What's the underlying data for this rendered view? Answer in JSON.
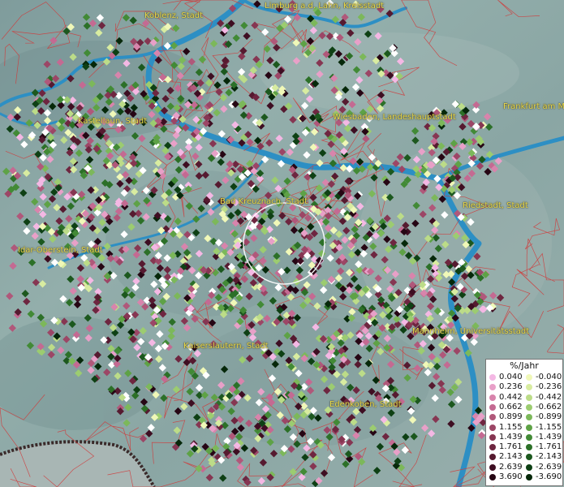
{
  "colors": {
    "river": "#2d8fc4",
    "border": "#d03a3a",
    "city_label": "#e8d84a"
  },
  "cities": [
    {
      "name": "Koblenz, Stadt"
    },
    {
      "name": "Limburg a.d. Lahn, Kreisstadt"
    },
    {
      "name": "Kastellaun, Stadt"
    },
    {
      "name": "Wiesbaden, Landeshauptstadt"
    },
    {
      "name": "Frankfurt am M"
    },
    {
      "name": "Bad Kreuznach, Stadt"
    },
    {
      "name": "Riedstadt, Stadt"
    },
    {
      "name": "Idar-Oberstein, Stadt"
    },
    {
      "name": "Mannheim, Universitätsstadt"
    },
    {
      "name": "Kaiserslautern, Stadt"
    },
    {
      "name": "Edenkoben, Stadt"
    }
  ],
  "legend": {
    "title": "%/Jahr",
    "positive": [
      {
        "label": "0.040",
        "color": "#f4b8e4"
      },
      {
        "label": "0.236",
        "color": "#e8a0c8"
      },
      {
        "label": "0.442",
        "color": "#d884ac"
      },
      {
        "label": "0.662",
        "color": "#c46a92"
      },
      {
        "label": "0.899",
        "color": "#b0587a"
      },
      {
        "label": "1.155",
        "color": "#9c4666"
      },
      {
        "label": "1.439",
        "color": "#863652"
      },
      {
        "label": "1.761",
        "color": "#6e2640"
      },
      {
        "label": "2.143",
        "color": "#561a30"
      },
      {
        "label": "2.639",
        "color": "#3e0e22"
      },
      {
        "label": "3.690",
        "color": "#260614"
      }
    ],
    "negative": [
      {
        "label": "-0.040",
        "color": "#f0f8b8"
      },
      {
        "label": "-0.236",
        "color": "#d8eca0"
      },
      {
        "label": "-0.442",
        "color": "#bcdc88"
      },
      {
        "label": "-0.662",
        "color": "#9ccc70"
      },
      {
        "label": "-0.899",
        "color": "#7cb85a"
      },
      {
        "label": "-1.155",
        "color": "#5ea246"
      },
      {
        "label": "-1.439",
        "color": "#428a36"
      },
      {
        "label": "-1.761",
        "color": "#2c7028"
      },
      {
        "label": "-2.143",
        "color": "#1c581e"
      },
      {
        "label": "-2.639",
        "color": "#0e4014"
      },
      {
        "label": "-3.690",
        "color": "#06280a"
      }
    ]
  }
}
